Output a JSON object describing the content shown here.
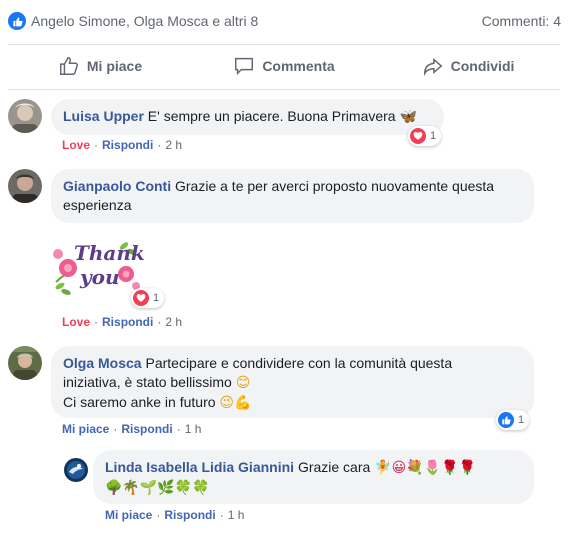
{
  "summary": {
    "names": "Angelo Simone, Olga Mosca e altri 8",
    "comments": "Commenti: 4"
  },
  "actions": {
    "like": "Mi piace",
    "comment": "Commenta",
    "share": "Condividi"
  },
  "comments": [
    {
      "author": "Luisa Upper",
      "text": "E' sempre un piacere. Buona Primavera",
      "text_emoji": "🦋",
      "reaction_label": "Love",
      "reply": "Rispondi",
      "time": "2 h",
      "reaction_count": "1"
    },
    {
      "author": "Gianpaolo Conti",
      "text_line1": "Grazie a te per averci proposto nuovamente questa",
      "text_line2": "esperienza",
      "sticker_text": "Thank you",
      "reaction_label": "Love",
      "reply": "Rispondi",
      "time": "2 h",
      "reaction_count": "1"
    },
    {
      "author": "Olga Mosca",
      "text_line1": "Partecipare e condividere con la comunità questa",
      "text_line2": "iniziativa, è stato bellissimo",
      "text_line2_emoji": "😊",
      "text_line3": "Ci saremo anke in futuro",
      "text_line3_emoji": "😉💪",
      "reaction_label": "Mi piace",
      "reply": "Rispondi",
      "time": "1 h",
      "reaction_count": "1"
    },
    {
      "author": "Linda Isabella Lidia Giannini",
      "text": "Grazie cara",
      "text_emoji": "🧚😀💐🌷🌹🌹",
      "text_line2_emoji": "🌳🌴🌱🌿🍀🍀",
      "reaction_label": "Mi piace",
      "reply": "Rispondi",
      "time": "1 h"
    }
  ],
  "colors": {
    "link": "#385898",
    "love": "#f33e58",
    "like": "#1877f2",
    "bubble": "#f2f3f5"
  }
}
